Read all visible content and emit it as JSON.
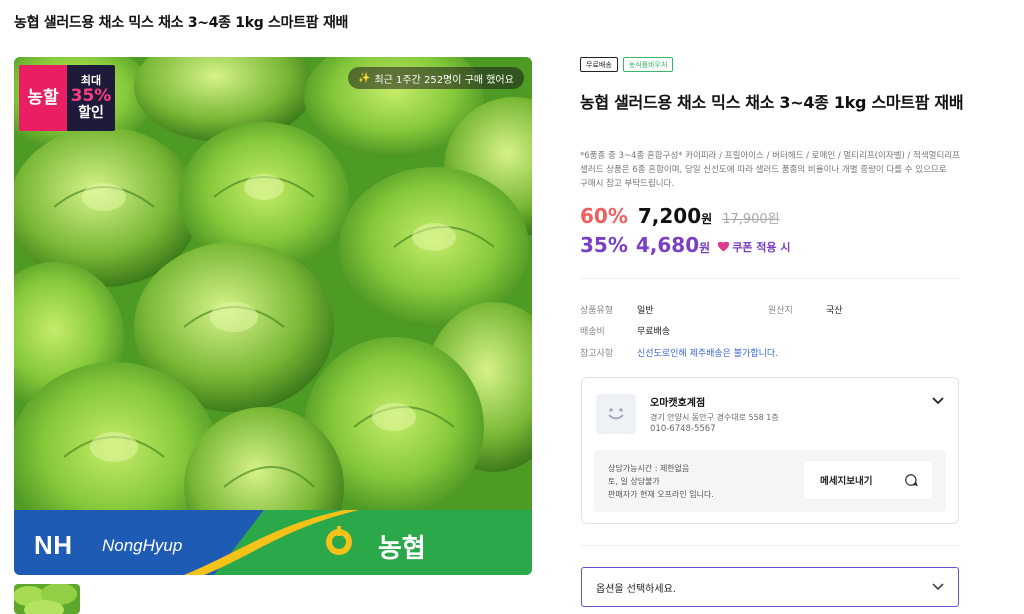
{
  "page": {
    "title": "농협 샐러드용 채소 믹스 채소 3~4종 1kg 스마트팜 재배"
  },
  "image": {
    "badge": {
      "left": "농할",
      "top": "최대",
      "percent": "35%",
      "bottom": "할인"
    },
    "recent_pill": "최근 1주간 252명이 구매 했어요",
    "brand_logo": "NH",
    "brand_text": "NongHyup",
    "brand_korean": "농협",
    "colors": {
      "lettuce": "#7cc33a",
      "lettuce_dark": "#3f8a1e",
      "brand_blue": "#1e5bb5",
      "brand_green": "#2aa84a",
      "brand_yellow": "#f6c21a"
    }
  },
  "product": {
    "tags": [
      "무료배송",
      "농식품바우처"
    ],
    "name": "농협 샐러드용 채소 믹스 채소 3~4종 1kg 스마트팜 재배",
    "description": "*6품종 중 3~4종 혼합구성* 카이피라 / 프릴아이스 / 버터헤드 / 로메인 / 멀티리프(이자벨) / 적색멀티리프 샐러드 상품은 6종 혼합이며, 당일 신선도에 따라 샐러드 품종의 비율이나 개별 중량이 다를 수 있으므로 구매시 참고 부탁드립니다."
  },
  "price": {
    "discount_rate": "60%",
    "sale_price": "7,200",
    "currency": "원",
    "original_price": "17,900원",
    "coupon_rate": "35%",
    "coupon_price": "4,680",
    "coupon_label": "쿠폰 적용 시"
  },
  "info": {
    "type_label": "상품유형",
    "type_value": "일반",
    "origin_label": "원산지",
    "origin_value": "국산",
    "shipping_label": "배송비",
    "shipping_value": "무료배송",
    "notice_label": "참고사항",
    "notice_value": "신선도로인해 제주배송은 불가합니다."
  },
  "seller": {
    "name": "오마캣호계점",
    "address": "경기 안양시 동안구 경수대로 558 1층",
    "phone": "010-6748-5567",
    "consult_hours": "상담가능시간 : 제한없음",
    "consult_weekend": "토, 일 상담불가",
    "status": "판매자가 현재 오프라인 입니다.",
    "message_button": "메세지보내기"
  },
  "option": {
    "placeholder": "옵션을 선택하세요."
  }
}
